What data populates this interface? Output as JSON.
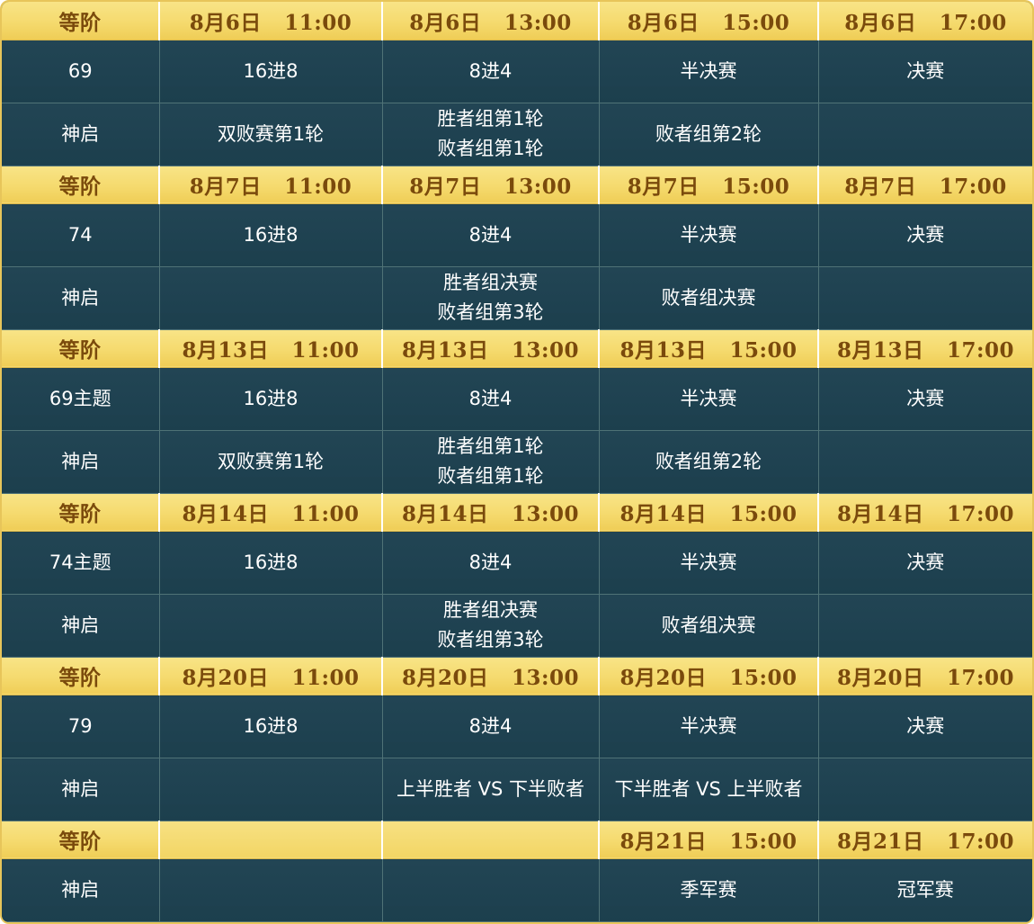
{
  "sections": [
    {
      "header": {
        "label": "等阶",
        "slots": [
          "8月6日   11:00",
          "8月6日   13:00",
          "8月6日   15:00",
          "8月6日   17:00"
        ]
      },
      "rows": [
        {
          "tier": "69",
          "cells": [
            [
              "16进8"
            ],
            [
              "8进4"
            ],
            [
              "半决赛"
            ],
            [
              "决赛"
            ]
          ]
        },
        {
          "tier": "神启",
          "cells": [
            [
              "双败赛第1轮"
            ],
            [
              "胜者组第1轮",
              "败者组第1轮"
            ],
            [
              "败者组第2轮"
            ],
            []
          ]
        }
      ]
    },
    {
      "header": {
        "label": "等阶",
        "slots": [
          "8月7日   11:00",
          "8月7日   13:00",
          "8月7日   15:00",
          "8月7日   17:00"
        ]
      },
      "rows": [
        {
          "tier": "74",
          "cells": [
            [
              "16进8"
            ],
            [
              "8进4"
            ],
            [
              "半决赛"
            ],
            [
              "决赛"
            ]
          ]
        },
        {
          "tier": "神启",
          "cells": [
            [],
            [
              "胜者组决赛",
              "败者组第3轮"
            ],
            [
              "败者组决赛"
            ],
            []
          ]
        }
      ]
    },
    {
      "header": {
        "label": "等阶",
        "slots": [
          "8月13日   11:00",
          "8月13日   13:00",
          "8月13日   15:00",
          "8月13日   17:00"
        ]
      },
      "rows": [
        {
          "tier": "69主题",
          "cells": [
            [
              "16进8"
            ],
            [
              "8进4"
            ],
            [
              "半决赛"
            ],
            [
              "决赛"
            ]
          ]
        },
        {
          "tier": "神启",
          "cells": [
            [
              "双败赛第1轮"
            ],
            [
              "胜者组第1轮",
              "败者组第1轮"
            ],
            [
              "败者组第2轮"
            ],
            []
          ]
        }
      ]
    },
    {
      "header": {
        "label": "等阶",
        "slots": [
          "8月14日   11:00",
          "8月14日   13:00",
          "8月14日   15:00",
          "8月14日   17:00"
        ]
      },
      "rows": [
        {
          "tier": "74主题",
          "cells": [
            [
              "16进8"
            ],
            [
              "8进4"
            ],
            [
              "半决赛"
            ],
            [
              "决赛"
            ]
          ]
        },
        {
          "tier": "神启",
          "cells": [
            [],
            [
              "胜者组决赛",
              "败者组第3轮"
            ],
            [
              "败者组决赛"
            ],
            []
          ]
        }
      ]
    },
    {
      "header": {
        "label": "等阶",
        "slots": [
          "8月20日   11:00",
          "8月20日   13:00",
          "8月20日   15:00",
          "8月20日   17:00"
        ]
      },
      "rows": [
        {
          "tier": "79",
          "cells": [
            [
              "16进8"
            ],
            [
              "8进4"
            ],
            [
              "半决赛"
            ],
            [
              "决赛"
            ]
          ]
        },
        {
          "tier": "神启",
          "cells": [
            [],
            [
              "上半胜者 VS 下半败者"
            ],
            [
              "下半胜者 VS 上半败者"
            ],
            []
          ]
        }
      ]
    },
    {
      "header": {
        "label": "等阶",
        "slots": [
          "",
          "",
          "8月21日   15:00",
          "8月21日   17:00"
        ]
      },
      "rows": [
        {
          "tier": "神启",
          "cells": [
            [],
            [],
            [
              "季军赛"
            ],
            [
              "冠军赛"
            ]
          ]
        }
      ]
    }
  ]
}
